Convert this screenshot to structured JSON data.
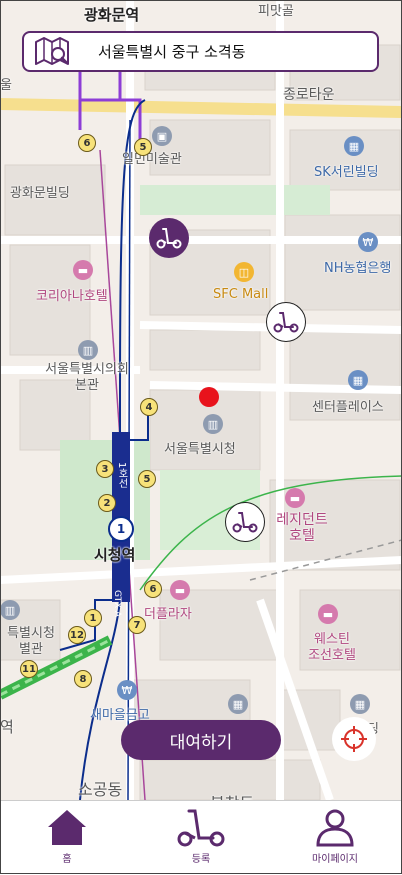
{
  "location_bar": {
    "address": "서울특별시 중구 소격동",
    "icon": "map-search-icon"
  },
  "map": {
    "station_labels": {
      "gwanghwamun": "광화문역",
      "cityhall": "시청역",
      "cityhall_exit_line1": "1호선",
      "cityhall_exit_line2": "GTX-A",
      "line_number": "1"
    },
    "place_labels": {
      "pittgwan": "피맛골",
      "gwanghwamun_building": "광화문빌딩",
      "ilmin": "일민미술관",
      "koreana": "코리아나호텔",
      "sfc_mall": "SFC Mall",
      "sk_seorin": "SK서린빌딩",
      "nh_bank": "NH농협은행",
      "jongno_town": "종로타운",
      "council_line1": "서울특별시의회",
      "council_line2": "본관",
      "city_hall": "서울특별시청",
      "center_place": "센터플레이스",
      "residence_line1": "레지던트",
      "residence_line2": "호텔",
      "the_plaza": "더플라자",
      "westin_line1": "웨스틴",
      "westin_line2": "조선호텔",
      "saemaul": "새마을금고",
      "cityhall_annex_line1": "특별시청",
      "cityhall_annex_line2": "별관",
      "sogong": "소공동",
      "bukchang": "북창동",
      "left_edge_1": "울",
      "left_edge_2": "역",
      "right_dul": "일딩"
    },
    "exit_numbers": [
      "6",
      "5",
      "4",
      "3",
      "5",
      "2",
      "6",
      "1",
      "7",
      "12",
      "11",
      "8"
    ],
    "pins": {
      "available": "scooter-available-icon",
      "reserved": "scooter-filled-icon"
    }
  },
  "actions": {
    "rent_label": "대여하기",
    "locate_icon": "crosshair-icon"
  },
  "tabbar": {
    "tabs": [
      {
        "label": "홈",
        "icon": "home-icon"
      },
      {
        "label": "등록",
        "icon": "scooter-icon"
      },
      {
        "label": "마이페이지",
        "icon": "person-icon"
      }
    ]
  },
  "colors": {
    "brand": "#5b2a6d",
    "marker_red": "#e8131c",
    "line1": "#0b2d8c",
    "green_line": "#3cb44b"
  }
}
